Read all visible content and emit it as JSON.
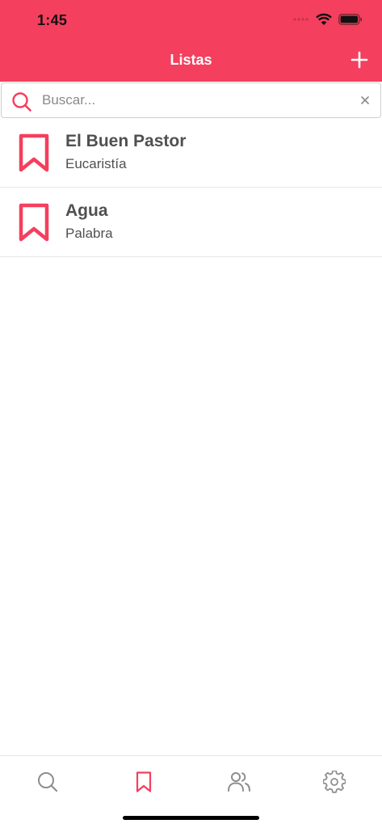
{
  "status_bar": {
    "time": "1:45"
  },
  "header": {
    "title": "Listas"
  },
  "search": {
    "placeholder": "Buscar..."
  },
  "lists": [
    {
      "title": "El Buen Pastor",
      "subtitle": "Eucaristía"
    },
    {
      "title": "Agua",
      "subtitle": "Palabra"
    }
  ],
  "tabs": [
    {
      "icon": "search-icon",
      "active": false
    },
    {
      "icon": "bookmark-icon",
      "active": true
    },
    {
      "icon": "users-icon",
      "active": false
    },
    {
      "icon": "gear-icon",
      "active": false
    }
  ],
  "colors": {
    "accent": "#f43f5e",
    "text": "#505050",
    "inactive_icon": "#8e8e8e",
    "divider": "#e6e6e6"
  }
}
